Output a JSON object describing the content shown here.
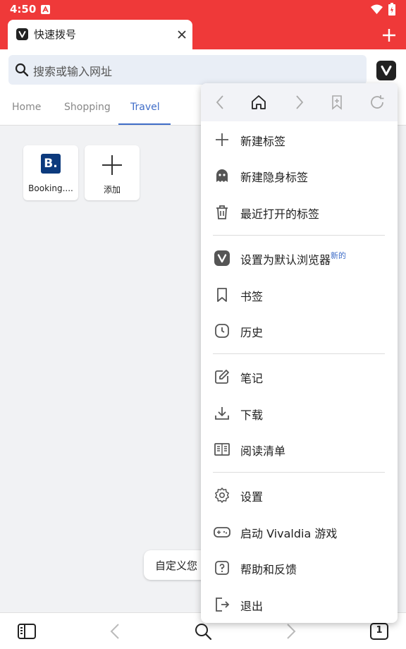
{
  "status": {
    "time": "4:50"
  },
  "tab": {
    "title": "快速拨号"
  },
  "search": {
    "placeholder": "搜索或输入网址"
  },
  "speed_dial": {
    "tabs": [
      "Home",
      "Shopping",
      "Travel"
    ],
    "active_tab": "Travel",
    "tiles": [
      {
        "logo": "B.",
        "label": "Booking...."
      },
      {
        "label": "添加"
      }
    ],
    "tooltip": "自定义您"
  },
  "menu": {
    "items": [
      {
        "label": "新建标签",
        "icon": "plus-icon"
      },
      {
        "label": "新建隐身标签",
        "icon": "ghost-icon"
      },
      {
        "label": "最近打开的标签",
        "icon": "trash-icon"
      },
      {
        "label": "设置为默认浏览器",
        "badge": "新的",
        "icon": "vivaldi-icon"
      },
      {
        "label": "书签",
        "icon": "bookmark-icon"
      },
      {
        "label": "历史",
        "icon": "clock-icon"
      },
      {
        "label": "笔记",
        "icon": "note-icon"
      },
      {
        "label": "下载",
        "icon": "download-icon"
      },
      {
        "label": "阅读清单",
        "icon": "book-icon"
      },
      {
        "label": "设置",
        "icon": "gear-icon"
      },
      {
        "label": "启动 Vivaldia 游戏",
        "icon": "gamepad-icon"
      },
      {
        "label": "帮助和反馈",
        "icon": "help-icon"
      },
      {
        "label": "退出",
        "icon": "exit-icon"
      }
    ]
  },
  "bottom": {
    "tab_count": "1"
  },
  "colors": {
    "accent": "#ef3939",
    "link": "#3f6dc8"
  }
}
